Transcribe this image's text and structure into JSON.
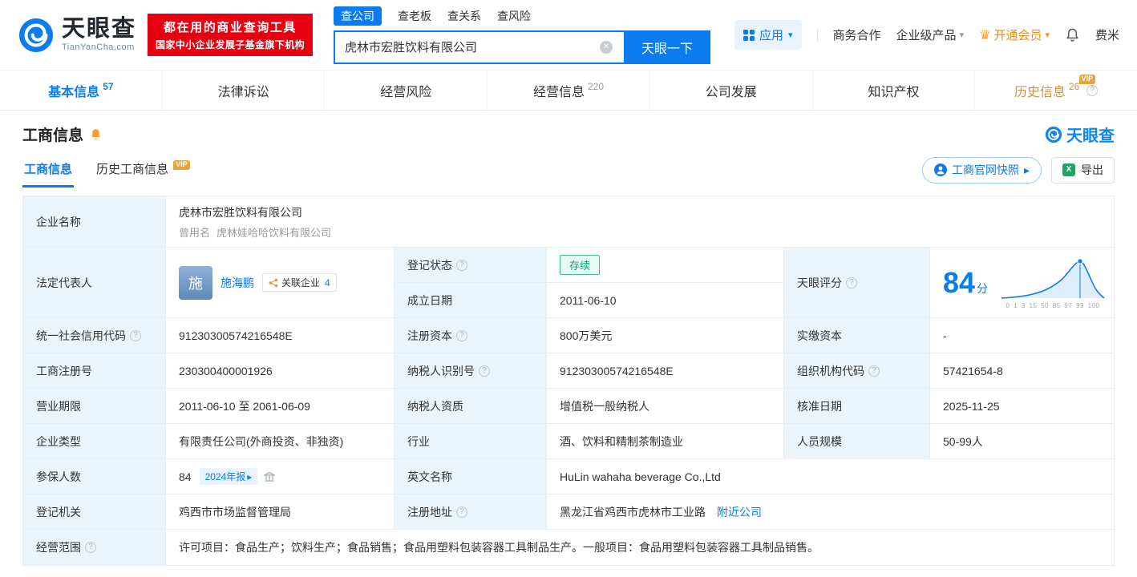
{
  "colors": {
    "accent": "#0a7cf0",
    "brand_red": "#e60012",
    "status_green": "#00a870",
    "vip_gold": "#e8a33d"
  },
  "icons": {
    "caret_down": "▾",
    "arrow_right": "▸",
    "crown": "♛",
    "clear": "✕",
    "help": "?",
    "excel_x": "X"
  },
  "header": {
    "logo": {
      "name": "天眼查",
      "domain": "TianYanCha.com"
    },
    "promo": {
      "line1": "都在用的商业查询工具",
      "line2": "国家中小企业发展子基金旗下机构"
    },
    "search": {
      "tabs": [
        {
          "label": "查公司"
        },
        {
          "label": "查老板"
        },
        {
          "label": "查关系"
        },
        {
          "label": "查风险"
        }
      ],
      "value": "虎林市宏胜饮料有限公司",
      "button": "天眼一下"
    },
    "menu": {
      "apps": "应用",
      "cooperation": "商务合作",
      "enterprise": "企业级产品",
      "membership": "开通会员",
      "username": "费米"
    }
  },
  "nav": {
    "tabs": [
      {
        "label": "基本信息",
        "count": "57"
      },
      {
        "label": "法律诉讼",
        "count": ""
      },
      {
        "label": "经营风险",
        "count": ""
      },
      {
        "label": "经营信息",
        "count": "220"
      },
      {
        "label": "公司发展",
        "count": ""
      },
      {
        "label": "知识产权",
        "count": ""
      },
      {
        "label": "历史信息",
        "count": "26",
        "vip": "VIP"
      }
    ]
  },
  "section": {
    "title": "工商信息",
    "brand": "天眼查",
    "tabs": [
      {
        "label": "工商信息"
      },
      {
        "label": "历史工商信息",
        "vip": "VIP"
      }
    ],
    "snapshot_button": "工商官网快照",
    "export_button": "导出"
  },
  "table": {
    "company_name": {
      "label": "企业名称",
      "value": "虎林市宏胜饮料有限公司",
      "former_label": "曾用名",
      "former_value": "虎林娃哈哈饮料有限公司"
    },
    "legal_rep": {
      "label": "法定代表人",
      "avatar": "施",
      "name": "施海鹏",
      "related_label": "关联企业",
      "related_count": "4"
    },
    "reg_status": {
      "label": "登记状态",
      "value": "存续"
    },
    "establish_date": {
      "label": "成立日期",
      "value": "2011-06-10"
    },
    "score": {
      "label": "天眼评分",
      "value": "84",
      "unit": "分",
      "ticks": "0 1 3 15 50 85 97 99 100"
    },
    "credit_code": {
      "label": "统一社会信用代码",
      "value": "91230300574216548E"
    },
    "reg_capital": {
      "label": "注册资本",
      "value": "800万美元"
    },
    "paid_capital": {
      "label": "实缴资本",
      "value": "-"
    },
    "reg_no": {
      "label": "工商注册号",
      "value": "230300400001926"
    },
    "taxpayer_no": {
      "label": "纳税人识别号",
      "value": "91230300574216548E"
    },
    "org_code": {
      "label": "组织机构代码",
      "value": "57421654-8"
    },
    "term": {
      "label": "营业期限",
      "value": "2011-06-10 至 2061-06-09"
    },
    "taxpayer_quality": {
      "label": "纳税人资质",
      "value": "增值税一般纳税人"
    },
    "approval_date": {
      "label": "核准日期",
      "value": "2025-11-25"
    },
    "company_type": {
      "label": "企业类型",
      "value": "有限责任公司(外商投资、非独资)"
    },
    "industry": {
      "label": "行业",
      "value": "酒、饮料和精制茶制造业"
    },
    "staff": {
      "label": "人员规模",
      "value": "50-99人"
    },
    "insured": {
      "label": "参保人数",
      "value": "84",
      "badge": "2024年报"
    },
    "english_name": {
      "label": "英文名称",
      "value": "HuLin wahaha beverage Co.,Ltd"
    },
    "authority": {
      "label": "登记机关",
      "value": "鸡西市市场监督管理局"
    },
    "address": {
      "label": "注册地址",
      "value": "黑龙江省鸡西市虎林市工业路",
      "link": "附近公司"
    },
    "scope": {
      "label": "经营范围",
      "value": "许可项目：食品生产；饮料生产；食品销售；食品用塑料包装容器工具制品生产。一般项目：食品用塑料包装容器工具制品销售。"
    }
  }
}
